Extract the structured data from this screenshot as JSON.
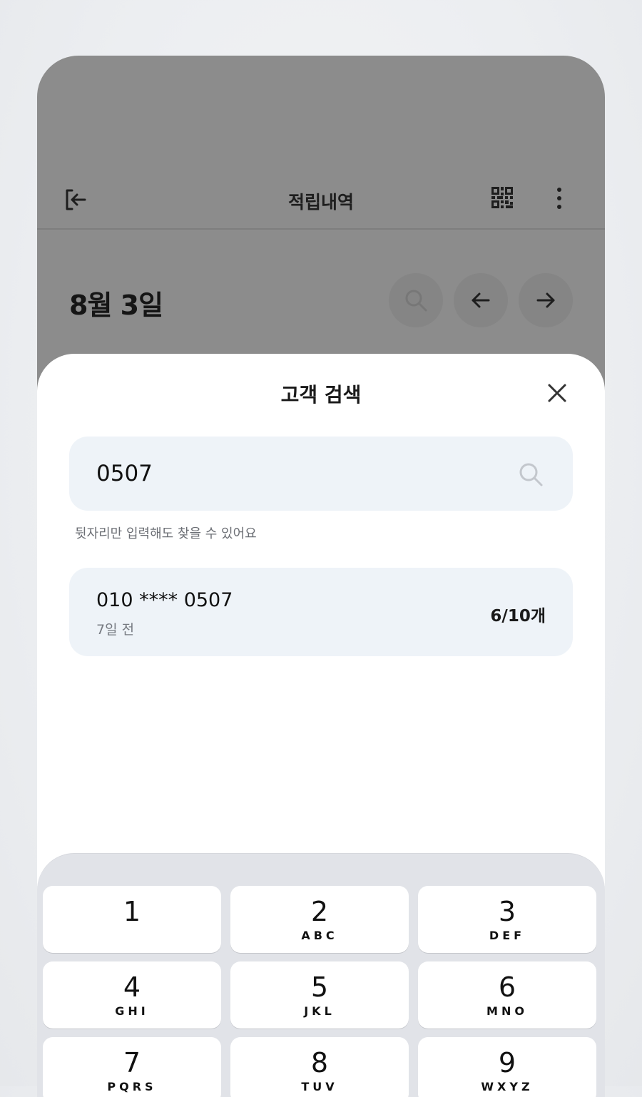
{
  "header": {
    "title": "적립내역"
  },
  "date_row": {
    "date": "8월 3일"
  },
  "sheet": {
    "title": "고객 검색",
    "search": {
      "value": "0507"
    },
    "hint": "뒷자리만 입력해도 찾을 수 있어요",
    "results": [
      {
        "phone": "010 **** 0507",
        "ago": "7일 전",
        "count": "6/10개"
      }
    ]
  },
  "keypad": {
    "keys": [
      {
        "num": "1",
        "letters": ""
      },
      {
        "num": "2",
        "letters": "ABC"
      },
      {
        "num": "3",
        "letters": "DEF"
      },
      {
        "num": "4",
        "letters": "GHI"
      },
      {
        "num": "5",
        "letters": "JKL"
      },
      {
        "num": "6",
        "letters": "MNO"
      },
      {
        "num": "7",
        "letters": "PQRS"
      },
      {
        "num": "8",
        "letters": "TUV"
      },
      {
        "num": "9",
        "letters": "WXYZ"
      }
    ]
  },
  "icons": [
    "exit-icon",
    "qr-code-icon",
    "more-vertical-icon",
    "search-icon",
    "arrow-left-icon",
    "arrow-right-icon",
    "close-icon"
  ],
  "colors": {
    "overlay": "#8c8c8c",
    "input_bg": "#eef3f8",
    "keypad_bg": "#e1e3e8"
  }
}
